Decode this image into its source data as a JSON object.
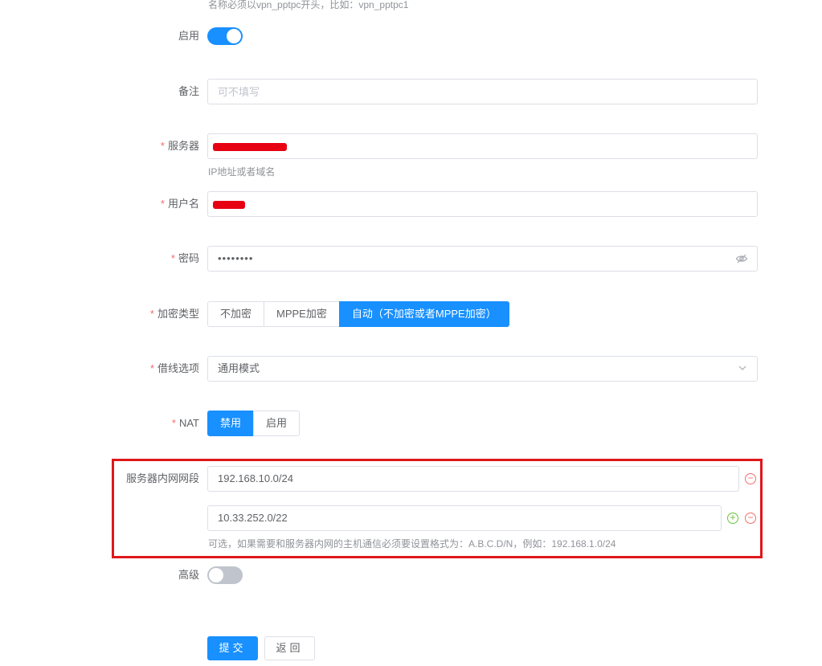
{
  "top_hint": "名称必须以vpn_pptpc开头，比如：vpn_pptpc1",
  "enable": {
    "label": "启用",
    "on": true
  },
  "remark": {
    "label": "备注",
    "placeholder": "可不填写"
  },
  "server": {
    "label": "服务器",
    "hint": "IP地址或者域名"
  },
  "username": {
    "label": "用户名"
  },
  "password": {
    "label": "密码",
    "value": "••••••••",
    "icon": "eye-hidden-icon"
  },
  "encryption": {
    "label": "加密类型",
    "options": [
      "不加密",
      "MPPE加密",
      "自动（不加密或者MPPE加密）"
    ],
    "selected": "自动（不加密或者MPPE加密）"
  },
  "line_option": {
    "label": "借线选项",
    "value": "通用模式"
  },
  "nat": {
    "label": "NAT",
    "options": [
      "禁用",
      "启用"
    ],
    "selected": "禁用"
  },
  "subnet": {
    "label": "服务器内网网段",
    "entries": [
      "192.168.10.0/24",
      "10.33.252.0/22"
    ],
    "hint": "可选，如果需要和服务器内网的主机通信必须要设置格式为：A.B.C.D/N，例如：192.168.1.0/24"
  },
  "advanced": {
    "label": "高级",
    "on": false
  },
  "actions": {
    "submit": "提交",
    "back": "返回"
  },
  "colors": {
    "primary": "#1890ff",
    "required": "#f56c6c",
    "redaction": "#e60012",
    "highlight": "#e0171b"
  }
}
